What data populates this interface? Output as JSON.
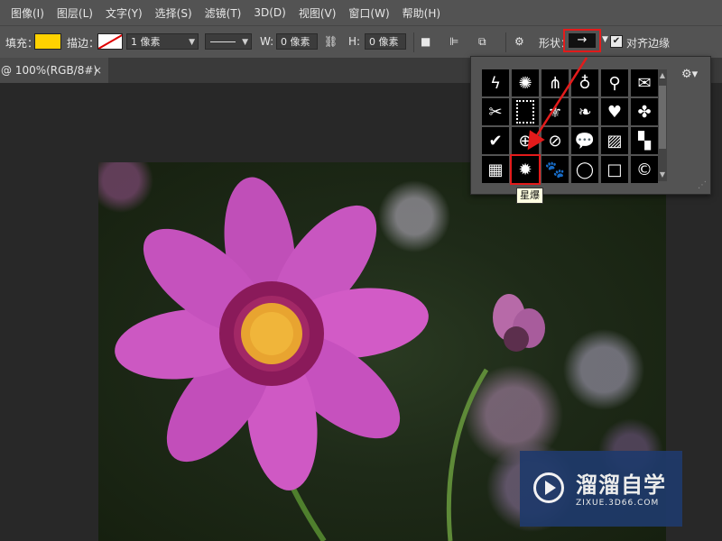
{
  "menubar": {
    "items": [
      "图像(I)",
      "图层(L)",
      "文字(Y)",
      "选择(S)",
      "滤镜(T)",
      "3D(D)",
      "视图(V)",
      "窗口(W)",
      "帮助(H)"
    ]
  },
  "options": {
    "fill_label": "填充：",
    "fill_color": "#ffd200",
    "stroke_label": "描边：",
    "stroke_width": "1 像素",
    "w_label": "W:",
    "w_value": "0 像素",
    "h_label": "H:",
    "h_value": "0 像素",
    "shape_label": "形状：",
    "shape_glyph": "→",
    "align_label": "对齐边缘",
    "align_checked": true
  },
  "tab": {
    "title": "@ 100%(RGB/8#)",
    "close": "×"
  },
  "shape_popup": {
    "shapes": [
      {
        "name": "lightning-shape"
      },
      {
        "name": "burst-shape"
      },
      {
        "name": "grass-shape"
      },
      {
        "name": "lightbulb-shape"
      },
      {
        "name": "pushpin-shape"
      },
      {
        "name": "envelope-shape"
      },
      {
        "name": "scissors-shape"
      },
      {
        "name": "stamp-frame-shape"
      },
      {
        "name": "fleur-de-lis-shape"
      },
      {
        "name": "ornament-shape"
      },
      {
        "name": "heart-shape"
      },
      {
        "name": "puzzle-shape"
      },
      {
        "name": "checkmark-shape"
      },
      {
        "name": "target-shape"
      },
      {
        "name": "no-sign-shape"
      },
      {
        "name": "speech-bubble-shape"
      },
      {
        "name": "diagonal-lines-shape"
      },
      {
        "name": "checker-shape"
      },
      {
        "name": "grid-shape"
      },
      {
        "name": "starburst-shape",
        "selected": true
      },
      {
        "name": "paw-print-shape"
      },
      {
        "name": "circle-frame-shape"
      },
      {
        "name": "square-frame-shape"
      },
      {
        "name": "copyright-shape"
      }
    ],
    "tooltip": "星爆"
  },
  "watermark": {
    "title": "溜溜自学",
    "url": "ZIXUE.3D66.COM"
  },
  "colors": {
    "ui_gray": "#535353",
    "highlight_red": "#e31b1b",
    "watermark_blue": "#1f3a6b"
  }
}
